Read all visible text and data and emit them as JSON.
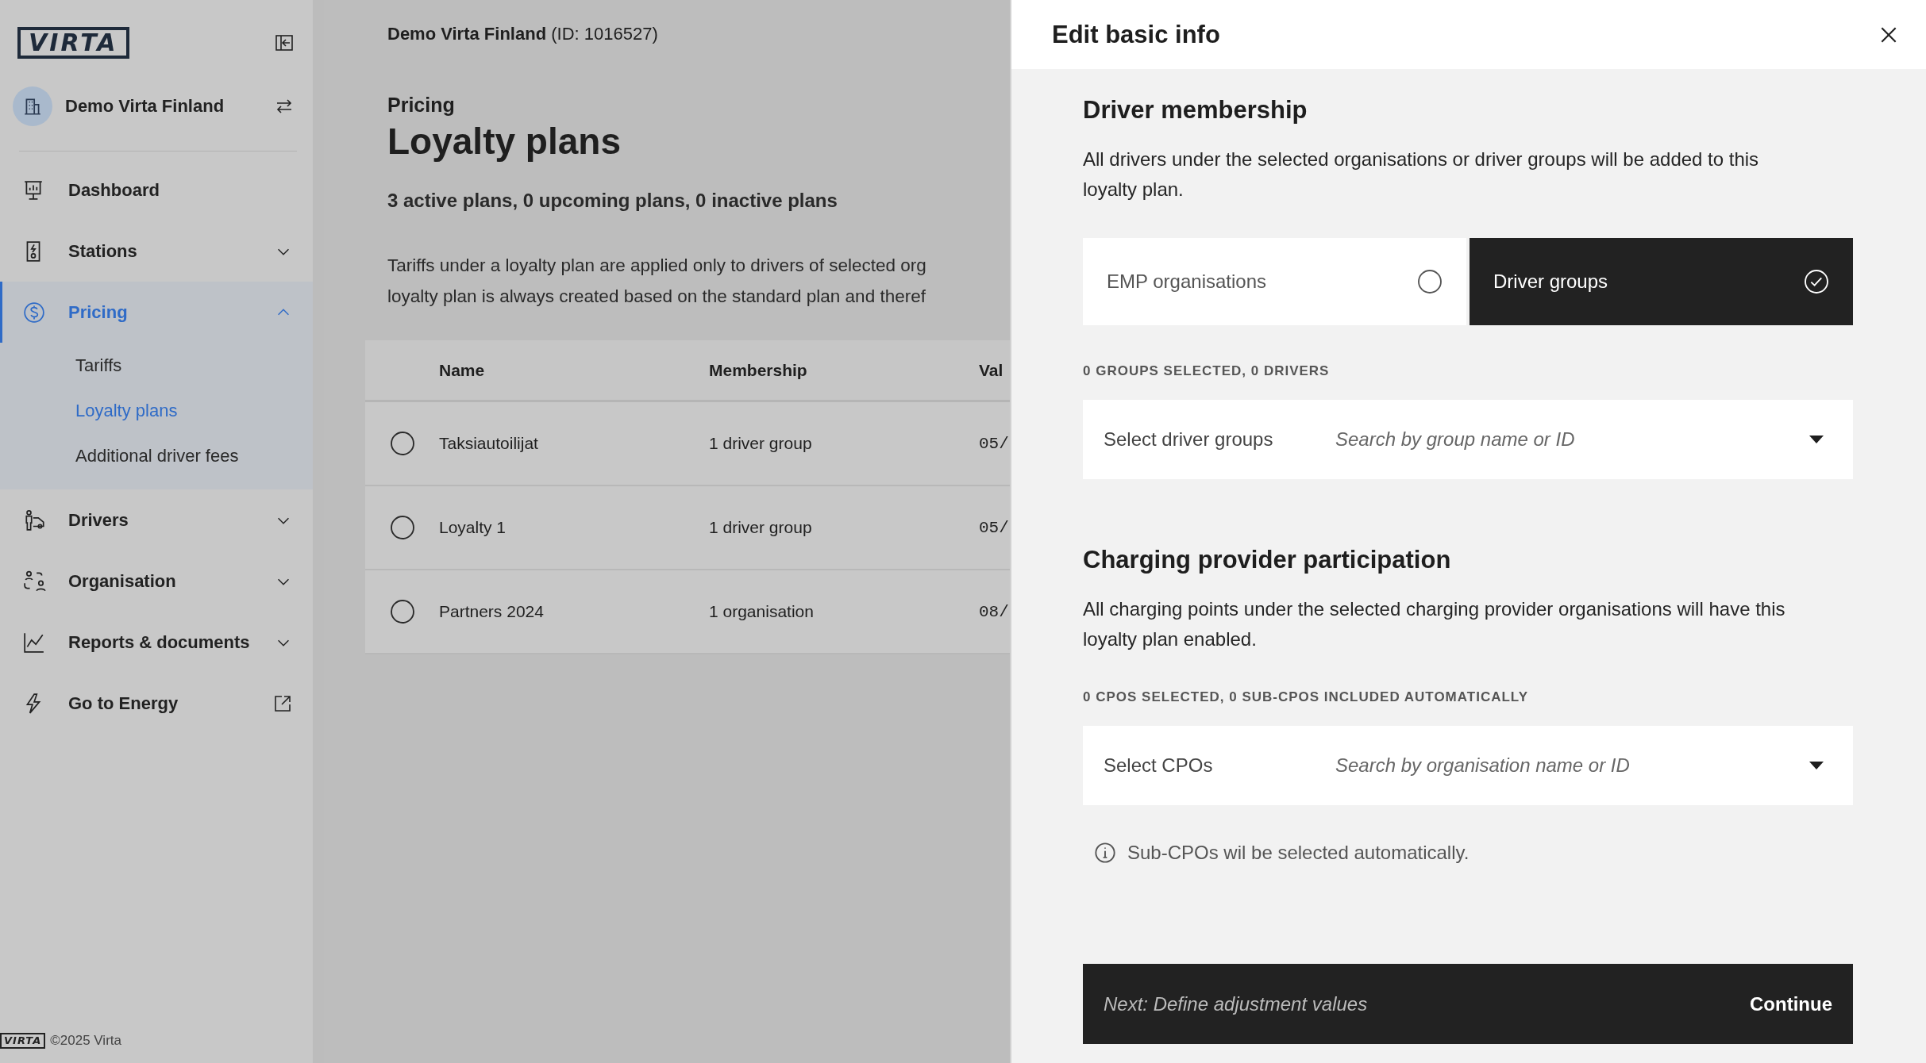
{
  "sidebar": {
    "logo": "VIRTA",
    "org_name": "Demo Virta Finland",
    "items": [
      {
        "label": "Dashboard",
        "kind": "link",
        "selected": false
      },
      {
        "label": "Stations",
        "kind": "expandable",
        "selected": false,
        "expanded": false
      },
      {
        "label": "Pricing",
        "kind": "expandable",
        "selected": true,
        "expanded": true,
        "children": [
          {
            "label": "Tariffs",
            "selected": false
          },
          {
            "label": "Loyalty plans",
            "selected": true
          },
          {
            "label": "Additional driver fees",
            "selected": false
          }
        ]
      },
      {
        "label": "Drivers",
        "kind": "expandable",
        "selected": false,
        "expanded": false
      },
      {
        "label": "Organisation",
        "kind": "expandable",
        "selected": false,
        "expanded": false
      },
      {
        "label": "Reports & documents",
        "kind": "expandable",
        "selected": false,
        "expanded": false
      },
      {
        "label": "Go to Energy",
        "kind": "external",
        "selected": false
      }
    ],
    "footer_logo": "VIRTA",
    "footer": "©2025 Virta"
  },
  "header": {
    "org_name": "Demo Virta Finland",
    "org_id": "(ID: 1016527)"
  },
  "page": {
    "breadcrumb": "Pricing",
    "title": "Loyalty plans",
    "summary": "3 active plans, 0 upcoming plans, 0 inactive plans",
    "description": [
      "Tariffs under a loyalty plan are applied only to drivers of selected org",
      "loyalty plan is always created based on the standard plan and theref"
    ]
  },
  "table": {
    "columns": [
      "Name",
      "Membership",
      "Val"
    ],
    "rows": [
      {
        "selected": false,
        "cells": [
          "Taksiautoilijat",
          "1 driver group",
          "05/"
        ]
      },
      {
        "selected": false,
        "cells": [
          "Loyalty 1",
          "1 driver group",
          "05/"
        ]
      },
      {
        "selected": false,
        "cells": [
          "Partners 2024",
          "1 organisation",
          "08/"
        ]
      }
    ]
  },
  "dialog": {
    "title": "Edit basic info",
    "sections": [
      {
        "heading": "Driver membership",
        "text": "All drivers under the selected organisations or driver groups will be added to this loyalty plan.",
        "options": [
          {
            "label": "EMP organisations",
            "selected": false
          },
          {
            "label": "Driver groups",
            "selected": true
          }
        ],
        "counter": "0 GROUPS SELECTED, 0 DRIVERS",
        "select": {
          "label": "Select driver groups",
          "placeholder": "Search by group name or ID"
        }
      },
      {
        "heading": "Charging provider participation",
        "text": "All charging points under the selected charging provider organisations will have this loyalty plan enabled.",
        "counter": "0 CPOS SELECTED, 0 SUB-CPOS INCLUDED AUTOMATICALLY",
        "select": {
          "label": "Select CPOs",
          "placeholder": "Search by organisation name or ID"
        },
        "note": "Sub-CPOs wil be selected automatically."
      }
    ],
    "footer": {
      "next": "Next: Define adjustment values",
      "action": "Continue"
    }
  }
}
